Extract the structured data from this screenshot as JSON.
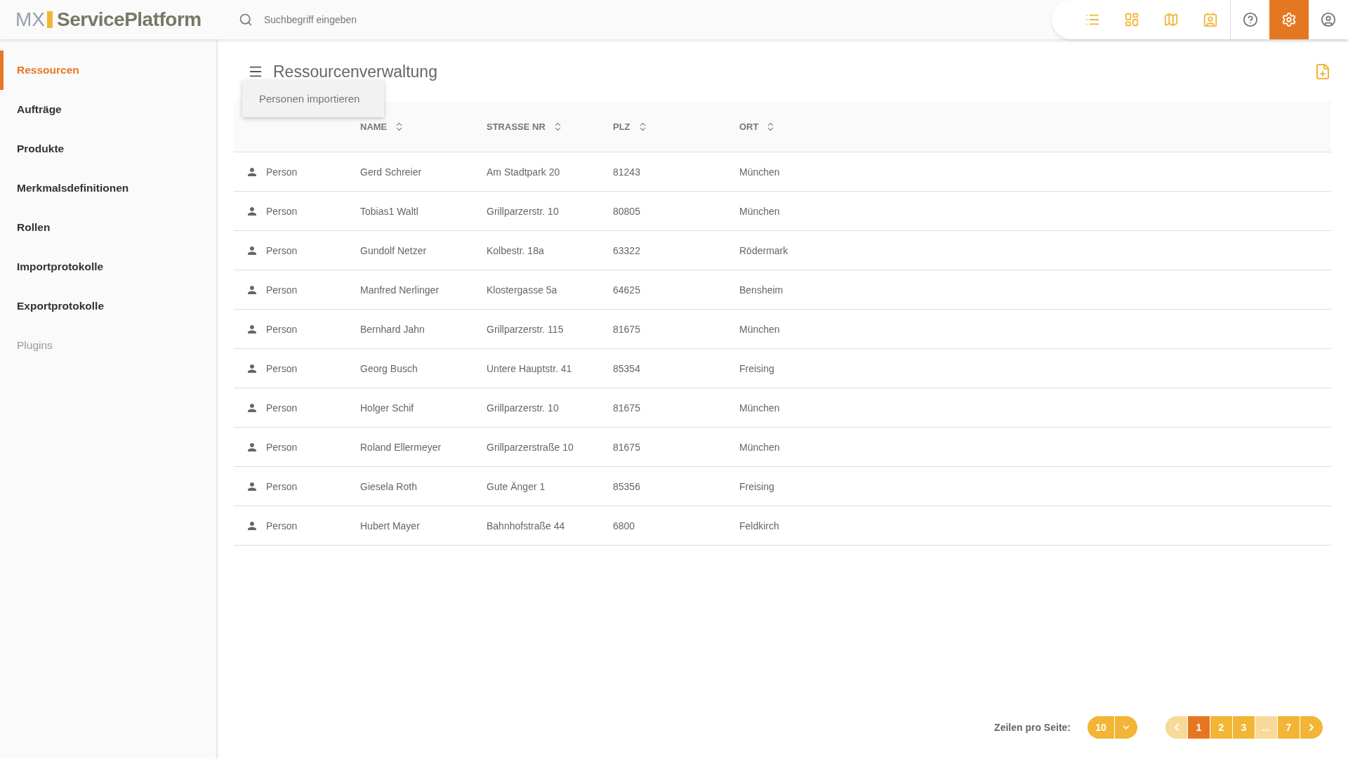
{
  "header": {
    "logo_prefix": "MX",
    "logo_name": "ServicePlatform",
    "search": {
      "placeholder": "Suchbegriff eingeben"
    },
    "toolbar": [
      {
        "selected": false
      },
      {
        "selected": false
      },
      {
        "selected": false
      },
      {
        "selected": false
      },
      {
        "selected": false
      },
      {
        "selected": true
      },
      {
        "selected": false
      }
    ]
  },
  "sidebar": {
    "items": [
      {
        "label": "Ressourcen",
        "selected": true,
        "disabled": false
      },
      {
        "label": "Aufträge",
        "selected": false,
        "disabled": false
      },
      {
        "label": "Produkte",
        "selected": false,
        "disabled": false
      },
      {
        "label": "Merkmalsdefinitionen",
        "selected": false,
        "disabled": false
      },
      {
        "label": "Rollen",
        "selected": false,
        "disabled": false
      },
      {
        "label": "Importprotokolle",
        "selected": false,
        "disabled": false
      },
      {
        "label": "Exportprotokolle",
        "selected": false,
        "disabled": false
      },
      {
        "label": "Plugins",
        "selected": false,
        "disabled": true
      }
    ]
  },
  "page": {
    "title": "Ressourcenverwaltung",
    "menu": {
      "items": [
        "Personen importieren"
      ]
    }
  },
  "table": {
    "columns": [
      {
        "label": "NAME"
      },
      {
        "label": "STRASSE NR"
      },
      {
        "label": "PLZ"
      },
      {
        "label": "ORT"
      }
    ],
    "rows": [
      {
        "type": "Person",
        "name": "Gerd Schreier",
        "street": "Am Stadtpark 20",
        "plz": "81243",
        "ort": "München"
      },
      {
        "type": "Person",
        "name": "Tobias1 Waltl",
        "street": "Grillparzerstr. 10",
        "plz": "80805",
        "ort": "München"
      },
      {
        "type": "Person",
        "name": "Gundolf Netzer",
        "street": "Kolbestr. 18a",
        "plz": "63322",
        "ort": "Rödermark"
      },
      {
        "type": "Person",
        "name": "Manfred Nerlinger",
        "street": "Klostergasse 5a",
        "plz": "64625",
        "ort": "Bensheim"
      },
      {
        "type": "Person",
        "name": "Bernhard Jahn",
        "street": "Grillparzerstr. 115",
        "plz": "81675",
        "ort": "München"
      },
      {
        "type": "Person",
        "name": "Georg Busch",
        "street": "Untere Hauptstr. 41",
        "plz": "85354",
        "ort": "Freising"
      },
      {
        "type": "Person",
        "name": "Holger Schif",
        "street": "Grillparzerstr. 10",
        "plz": "81675",
        "ort": "München"
      },
      {
        "type": "Person",
        "name": "Roland Ellermeyer",
        "street": "Grillparzerstraße 10",
        "plz": "81675",
        "ort": "München"
      },
      {
        "type": "Person",
        "name": "Giesela Roth",
        "street": "Gute Änger 1",
        "plz": "85356",
        "ort": "Freising"
      },
      {
        "type": "Person",
        "name": "Hubert Mayer",
        "street": "Bahnhofstraße 44",
        "plz": "6800",
        "ort": "Feldkirch"
      }
    ]
  },
  "pagination": {
    "rows_label": "Zeilen pro Seite:",
    "rows_per_page": "10",
    "pages": [
      {
        "kind": "prev",
        "selected": false,
        "disabled": true
      },
      {
        "kind": "page",
        "label": "1",
        "selected": true,
        "disabled": false
      },
      {
        "kind": "page",
        "label": "2",
        "selected": false,
        "disabled": false
      },
      {
        "kind": "page",
        "label": "3",
        "selected": false,
        "disabled": false
      },
      {
        "kind": "page",
        "label": "...",
        "selected": false,
        "disabled": true
      },
      {
        "kind": "page",
        "label": "7",
        "selected": false,
        "disabled": false
      },
      {
        "kind": "next",
        "selected": false,
        "disabled": false
      }
    ]
  }
}
